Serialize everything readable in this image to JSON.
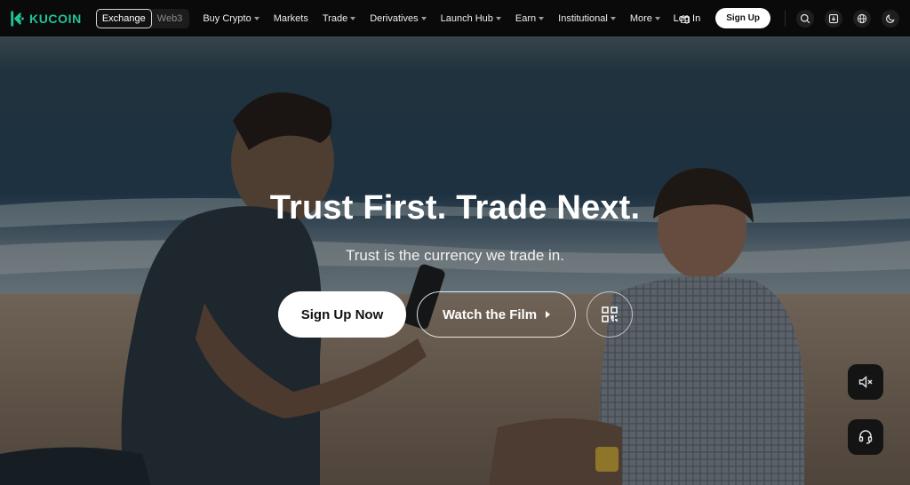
{
  "brand": {
    "name": "KUCOIN",
    "color": "#21c397"
  },
  "switch": {
    "exchange": "Exchange",
    "web3": "Web3"
  },
  "nav": [
    {
      "label": "Buy Crypto",
      "dropdown": true
    },
    {
      "label": "Markets",
      "dropdown": false
    },
    {
      "label": "Trade",
      "dropdown": true
    },
    {
      "label": "Derivatives",
      "dropdown": true
    },
    {
      "label": "Launch Hub",
      "dropdown": true
    },
    {
      "label": "Earn",
      "dropdown": true
    },
    {
      "label": "Institutional",
      "dropdown": true
    },
    {
      "label": "More",
      "dropdown": true
    }
  ],
  "auth": {
    "login": "Log In",
    "signup": "Sign Up"
  },
  "icons": [
    "gift-icon",
    "search-icon",
    "download-icon",
    "globe-icon",
    "theme-moon-icon",
    "qr-code-icon",
    "mute-icon",
    "support-headset-icon"
  ],
  "hero": {
    "title": "Trust First. Trade Next.",
    "subtitle": "Trust is the currency we trade in.",
    "primary_cta": "Sign Up Now",
    "secondary_cta": "Watch the Film"
  }
}
